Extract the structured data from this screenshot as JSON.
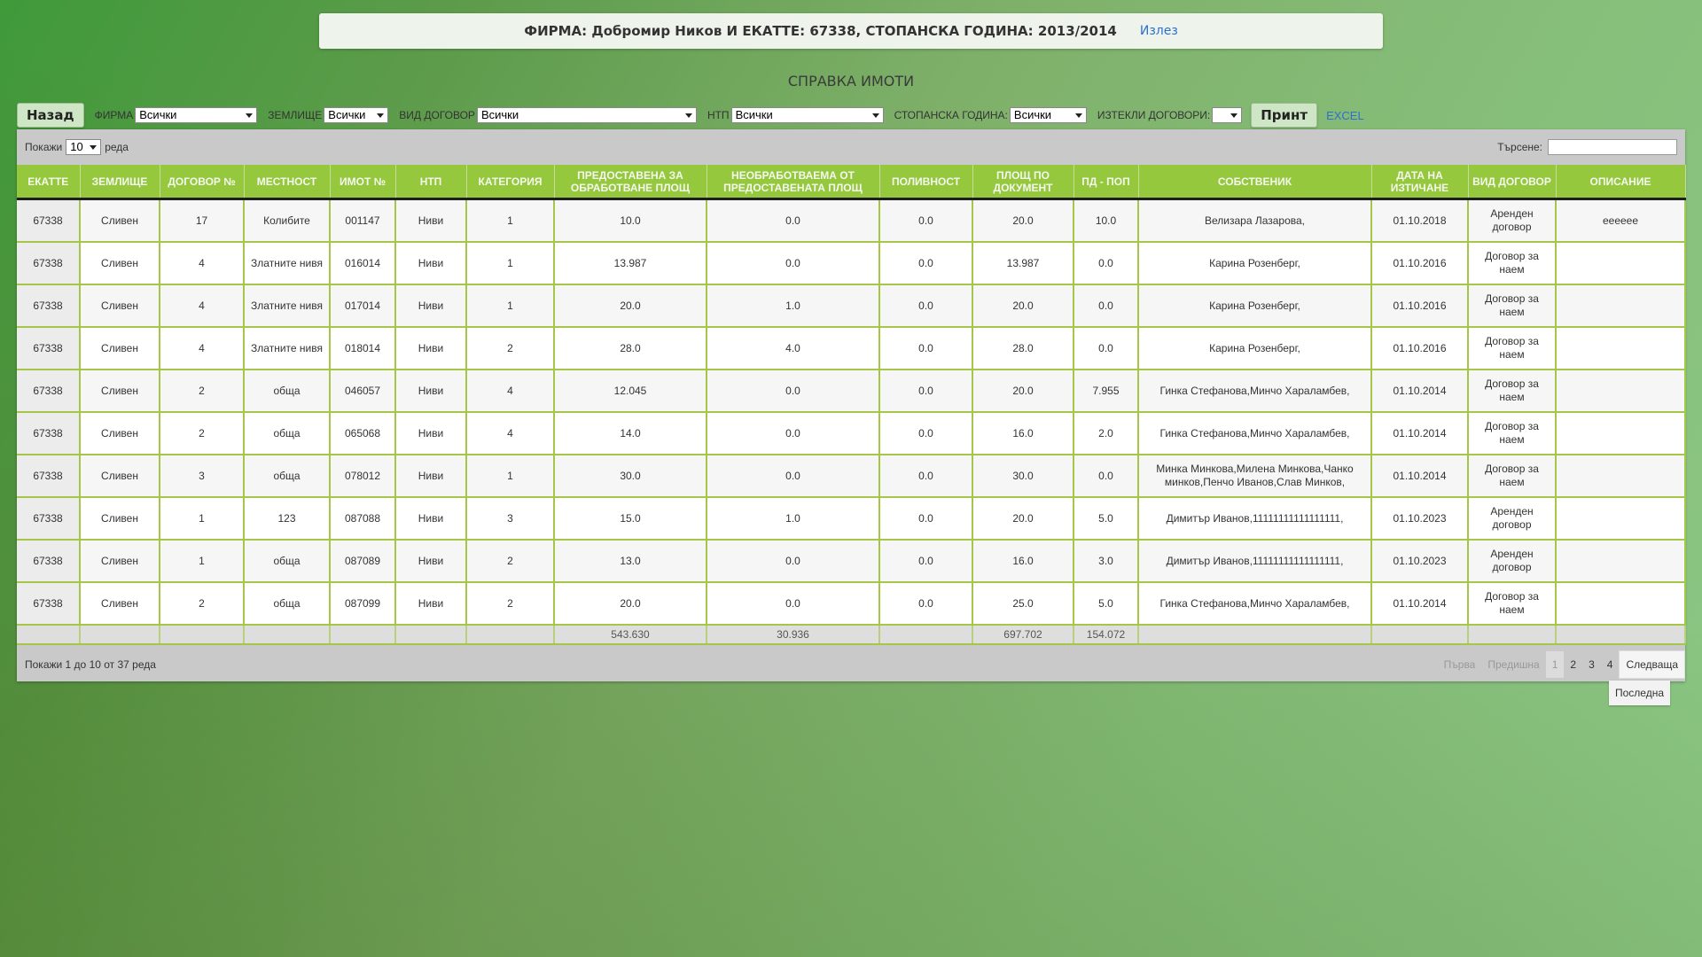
{
  "header": {
    "info": "ФИРМА: Добромир Ников И ЕКАТТЕ: 67338, СТОПАНСКА ГОДИНА: 2013/2014",
    "logout": "Излез"
  },
  "page_title": "СПРАВКА ИМОТИ",
  "filters": {
    "back": "Назад",
    "firm_label": "ФИРМА",
    "firm_value": "Всички",
    "land_label": "ЗЕМЛИЩЕ",
    "land_value": "Всички",
    "contract_label": "ВИД ДОГОВОР",
    "contract_value": "Всички",
    "ntp_label": "НТП",
    "ntp_value": "Всички",
    "year_label": "СТОПАНСКА ГОДИНА:",
    "year_value": "Всички",
    "expired_label": "ИЗТЕКЛИ ДОГОВОРИ:",
    "expired_value": "",
    "print": "Принт",
    "excel": "EXCEL"
  },
  "table_controls": {
    "show_prefix": "Покажи",
    "show_value": "10",
    "show_suffix": "реда",
    "search_label": "Търсене:",
    "search_value": ""
  },
  "columns": [
    "ЕКАТТЕ",
    "ЗЕМЛИЩЕ",
    "ДОГОВОР №",
    "МЕСТНОСТ",
    "ИМОТ №",
    "НТП",
    "КАТЕГОРИЯ",
    "ПРЕДОСТАВЕНА ЗА ОБРАБОТВАНЕ ПЛОЩ",
    "НЕОБРАБОТВАЕМА ОТ ПРЕДОСТАВЕНАТА ПЛОЩ",
    "ПОЛИВНОСТ",
    "ПЛОЩ ПО ДОКУМЕНТ",
    "ПД - ПОП",
    "СОБСТВЕНИК",
    "ДАТА НА ИЗТИЧАНЕ",
    "ВИД ДОГОВОР",
    "ОПИСАНИЕ"
  ],
  "rows": [
    [
      "67338",
      "Сливен",
      "17",
      "Колибите",
      "001147",
      "Ниви",
      "1",
      "10.0",
      "0.0",
      "0.0",
      "20.0",
      "10.0",
      "Велизара Лазарова,",
      "01.10.2018",
      "Арендeн договор",
      "eeeeee"
    ],
    [
      "67338",
      "Сливен",
      "4",
      "Златните нивя",
      "016014",
      "Ниви",
      "1",
      "13.987",
      "0.0",
      "0.0",
      "13.987",
      "0.0",
      "Карина Розенберг,",
      "01.10.2016",
      "Договор за наем",
      ""
    ],
    [
      "67338",
      "Сливен",
      "4",
      "Златните нивя",
      "017014",
      "Ниви",
      "1",
      "20.0",
      "1.0",
      "0.0",
      "20.0",
      "0.0",
      "Карина Розенберг,",
      "01.10.2016",
      "Договор за наем",
      ""
    ],
    [
      "67338",
      "Сливен",
      "4",
      "Златните нивя",
      "018014",
      "Ниви",
      "2",
      "28.0",
      "4.0",
      "0.0",
      "28.0",
      "0.0",
      "Карина Розенберг,",
      "01.10.2016",
      "Договор за наем",
      ""
    ],
    [
      "67338",
      "Сливен",
      "2",
      "обща",
      "046057",
      "Ниви",
      "4",
      "12.045",
      "0.0",
      "0.0",
      "20.0",
      "7.955",
      "Гинка Стефанова,Минчо Хараламбев,",
      "01.10.2014",
      "Договор за наем",
      ""
    ],
    [
      "67338",
      "Сливен",
      "2",
      "обща",
      "065068",
      "Ниви",
      "4",
      "14.0",
      "0.0",
      "0.0",
      "16.0",
      "2.0",
      "Гинка Стефанова,Минчо Хараламбев,",
      "01.10.2014",
      "Договор за наем",
      ""
    ],
    [
      "67338",
      "Сливен",
      "3",
      "обща",
      "078012",
      "Ниви",
      "1",
      "30.0",
      "0.0",
      "0.0",
      "30.0",
      "0.0",
      "Минка Минкова,Милена Минкова,Чанко минков,Пенчо Иванов,Слав Минков,",
      "01.10.2014",
      "Договор за наем",
      ""
    ],
    [
      "67338",
      "Сливен",
      "1",
      "123",
      "087088",
      "Ниви",
      "3",
      "15.0",
      "1.0",
      "0.0",
      "20.0",
      "5.0",
      "Димитър Иванов,11111111111111111,",
      "01.10.2023",
      "Арендeн договор",
      ""
    ],
    [
      "67338",
      "Сливен",
      "1",
      "обща",
      "087089",
      "Ниви",
      "2",
      "13.0",
      "0.0",
      "0.0",
      "16.0",
      "3.0",
      "Димитър Иванов,11111111111111111,",
      "01.10.2023",
      "Арендeн договор",
      ""
    ],
    [
      "67338",
      "Сливен",
      "2",
      "обща",
      "087099",
      "Ниви",
      "2",
      "20.0",
      "0.0",
      "0.0",
      "25.0",
      "5.0",
      "Гинка Стефанова,Минчо Хараламбев,",
      "01.10.2014",
      "Договор за наем",
      ""
    ]
  ],
  "totals": [
    "",
    "",
    "",
    "",
    "",
    "",
    "",
    "543.630",
    "30.936",
    "",
    "697.702",
    "154.072",
    "",
    "",
    "",
    ""
  ],
  "footer": {
    "info": "Покажи 1 до 10 от 37 реда",
    "pager": {
      "first": "Първа",
      "prev": "Предишна",
      "pages": [
        "1",
        "2",
        "3",
        "4"
      ],
      "next": "Следваща",
      "last": "Последна"
    }
  }
}
